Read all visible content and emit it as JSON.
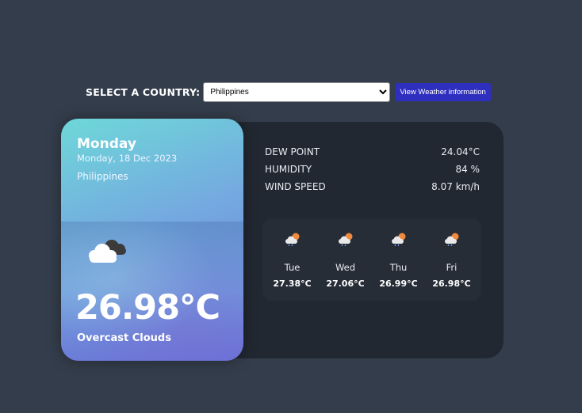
{
  "selector": {
    "label": "SELECT A COUNTRY:",
    "selected_country": "Philippines",
    "button_label": "View Weather information"
  },
  "current": {
    "day": "Monday",
    "date": "Monday, 18 Dec 2023",
    "location": "Philippines",
    "temperature": "26.98°C",
    "condition": "Overcast Clouds",
    "icon": "cloud-icon"
  },
  "details": [
    {
      "label": "DEW POINT",
      "value": "24.04°C"
    },
    {
      "label": "HUMIDITY",
      "value": "84 %"
    },
    {
      "label": "WIND SPEED",
      "value": "8.07 km/h"
    }
  ],
  "forecast": [
    {
      "day": "Tue",
      "temp": "27.38°C",
      "icon": "sun-cloud-rain-icon"
    },
    {
      "day": "Wed",
      "temp": "27.06°C",
      "icon": "sun-cloud-rain-icon"
    },
    {
      "day": "Thu",
      "temp": "26.99°C",
      "icon": "sun-cloud-rain-icon"
    },
    {
      "day": "Fri",
      "temp": "26.98°C",
      "icon": "sun-cloud-rain-icon"
    }
  ],
  "colors": {
    "background": "#343d4b",
    "panel": "#222831",
    "button": "#2f2fbf"
  }
}
